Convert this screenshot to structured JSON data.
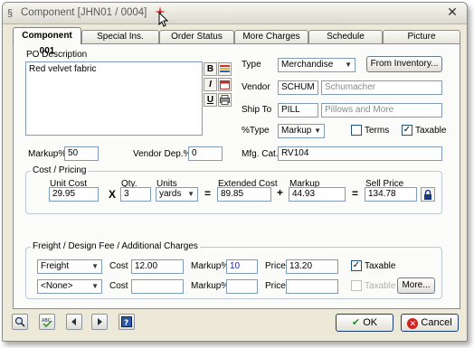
{
  "window": {
    "title": "Component [JHN01 / 0004]",
    "close_glyph": "✕"
  },
  "tabs": [
    {
      "label": "Component 001",
      "active": true
    },
    {
      "label": "Special Ins."
    },
    {
      "label": "Order Status"
    },
    {
      "label": "More Charges"
    },
    {
      "label": "Schedule"
    },
    {
      "label": "Picture"
    }
  ],
  "description": {
    "label": "PO Description",
    "value": "Red velvet fabric",
    "format_buttons": [
      "B",
      "I",
      "U"
    ]
  },
  "fields": {
    "type_label": "Type",
    "type_value": "Merchandise",
    "from_inventory_label": "From Inventory...",
    "vendor_label": "Vendor",
    "vendor_code": "SCHUM",
    "vendor_name": "Schumacher",
    "ship_to_label": "Ship To",
    "ship_to_code": "PILL",
    "ship_to_name": "Pillows and More",
    "pct_type_label": "%Type",
    "pct_type_value": "Markup",
    "terms_label": "Terms",
    "taxable_label": "Taxable",
    "markup_pct_label": "Markup%",
    "markup_pct_value": "50",
    "vendor_dep_label": "Vendor Dep.%",
    "vendor_dep_value": "0",
    "mfg_cat_label": "Mfg. Cat.",
    "mfg_cat_value": "RV104"
  },
  "cost": {
    "group_label": "Cost / Pricing",
    "unit_cost_label": "Unit Cost",
    "unit_cost": "29.95",
    "qty_label": "Qty.",
    "qty": "3",
    "units_label": "Units",
    "units": "yards",
    "ext_cost_label": "Extended Cost",
    "ext_cost": "89.85",
    "markup_label": "Markup",
    "markup": "44.93",
    "sell_label": "Sell Price",
    "sell": "134.78",
    "op_times": "X",
    "op_eq": "=",
    "op_plus": "+"
  },
  "freight": {
    "group_label": "Freight / Design Fee / Additional Charges",
    "cost_label": "Cost",
    "markup_label": "Markup%",
    "price_label": "Price",
    "taxable_label": "Taxable",
    "more_label": "More...",
    "row1": {
      "type": "Freight",
      "cost": "12.00",
      "markup": "10",
      "price": "13.20",
      "taxable": true
    },
    "row2": {
      "type": "<None>",
      "cost": "",
      "markup": "",
      "price": "",
      "taxable": false
    }
  },
  "footer": {
    "ok_label": "OK",
    "cancel_label": "Cancel"
  },
  "colors": {
    "ok_check": "#2a8a2a",
    "cancel_red": "#d02020",
    "sparkle": "#e02020"
  }
}
